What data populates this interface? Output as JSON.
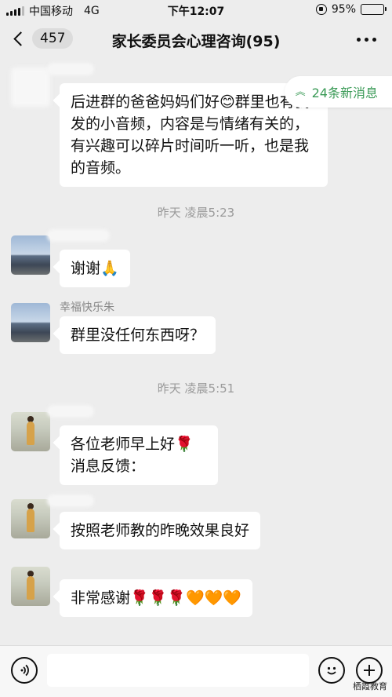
{
  "status_bar": {
    "carrier": "中国移动",
    "network": "4G",
    "time": "下午12:07",
    "battery": "95%",
    "battery_level": 0.95
  },
  "nav": {
    "back_count": "457",
    "title": "家长委员会心理咨询(95)"
  },
  "new_messages": {
    "label": "24条新消息"
  },
  "messages": [
    {
      "text": "后进群的爸爸妈妈们好😊群里也有我发的小音频，内容是与情绪有关的，有兴趣可以碎片时间听一听，也是我的音频。"
    },
    {
      "time": "昨天 凌晨5:23"
    },
    {
      "text": "谢谢🙏"
    },
    {
      "sender": "幸福快乐朱",
      "text": "群里没任何东西呀？"
    },
    {
      "time": "昨天 凌晨5:51"
    },
    {
      "line1": "各位老师早上好🌹",
      "line2": "消息反馈："
    },
    {
      "text": "按照老师教的昨晚效果良好"
    },
    {
      "text": "非常感谢🌹🌹🌹🧡🧡🧡"
    }
  ],
  "input_bar": {
    "placeholder": ""
  },
  "watermark": "栖霞教育"
}
